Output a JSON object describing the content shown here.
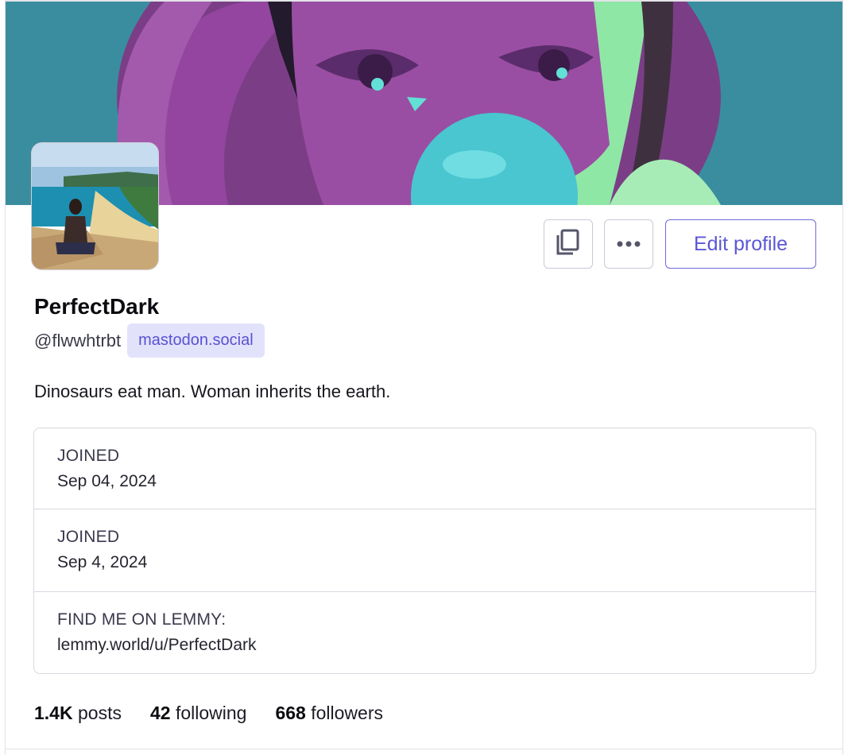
{
  "profile": {
    "display_name": "PerfectDark",
    "handle": "@flwwhtrbt",
    "domain": "mastodon.social",
    "bio": "Dinosaurs eat man. Woman inherits the earth."
  },
  "actions": {
    "edit_label": "Edit profile",
    "copy_icon": "copy-icon",
    "more_icon": "more-icon"
  },
  "fields": [
    {
      "label": "JOINED",
      "value": "Sep 04, 2024"
    },
    {
      "label": "JOINED",
      "value": "Sep 4, 2024"
    },
    {
      "label": "FIND ME ON LEMMY:",
      "value": "lemmy.world/u/PerfectDark"
    }
  ],
  "stats": {
    "posts_count": "1.4K",
    "posts_label": "posts",
    "following_count": "42",
    "following_label": "following",
    "followers_count": "668",
    "followers_label": "followers"
  },
  "colors": {
    "accent": "#5b57d6",
    "badge_bg": "#e3e2fb"
  }
}
